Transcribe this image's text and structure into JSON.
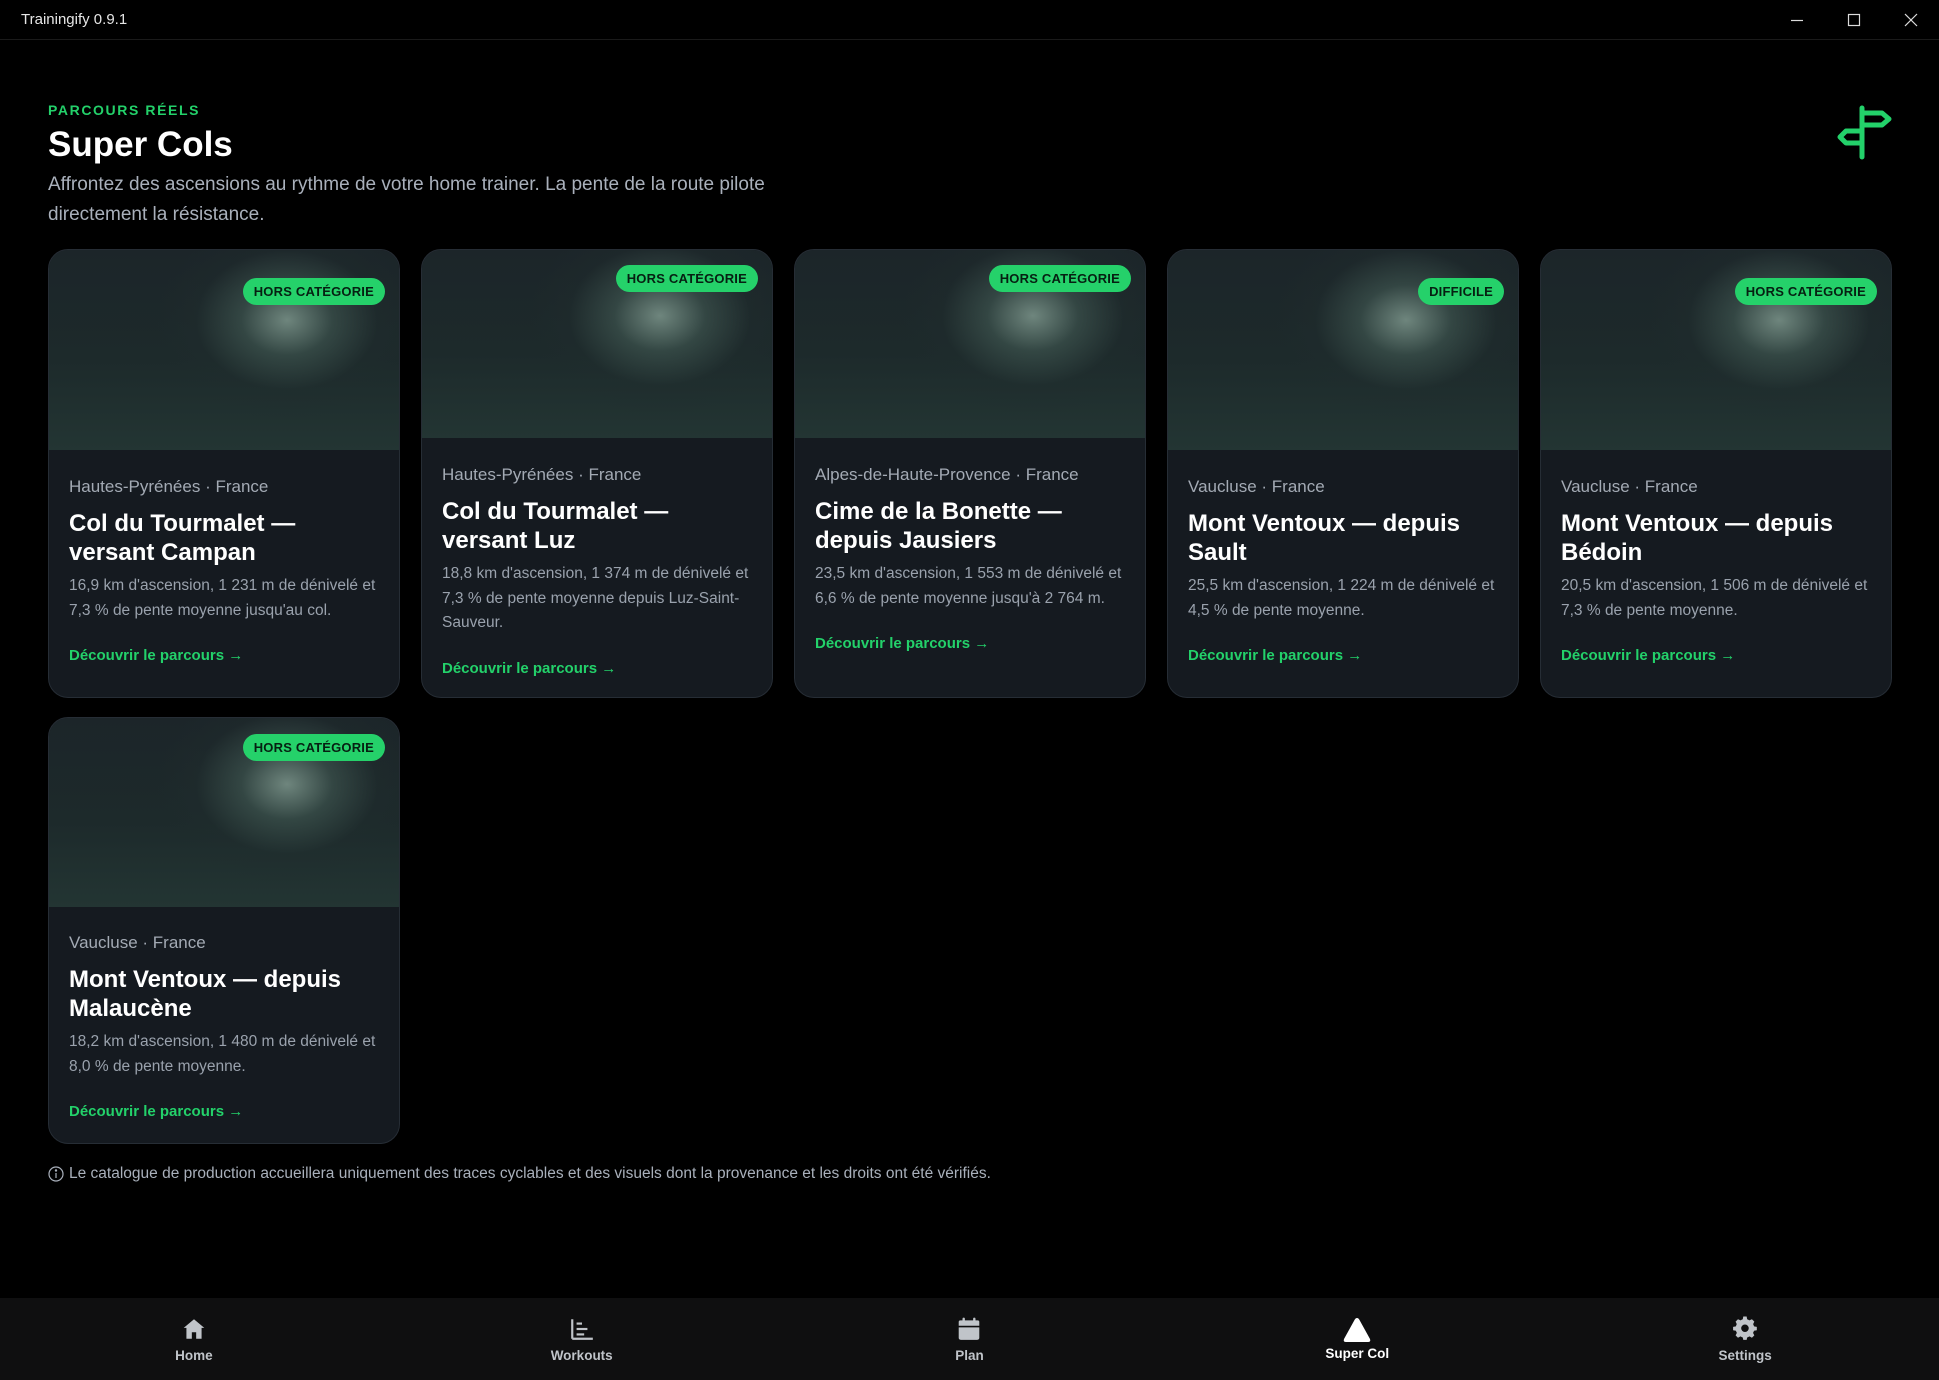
{
  "window": {
    "title": "Trainingify 0.9.1"
  },
  "header": {
    "eyebrow": "PARCOURS RÉELS",
    "title": "Super Cols",
    "subtitle": "Affrontez des ascensions au rythme de votre home trainer. La pente de la route pilote directement la résistance.",
    "icon": "signpost-icon"
  },
  "cards": [
    {
      "badge": "HORS CATÉGORIE",
      "region": "Hautes-Pyrénées · France",
      "title": "Col du Tourmalet — versant Campan",
      "description": "16,9 km d'ascension, 1 231 m de dénivelé et 7,3 % de pente moyenne jusqu'au col.",
      "link": "Découvrir le parcours →"
    },
    {
      "badge": "HORS CATÉGORIE",
      "region": "Hautes-Pyrénées · France",
      "title": "Col du Tourmalet — versant Luz",
      "description": "18,8 km d'ascension, 1 374 m de dénivelé et 7,3 % de pente moyenne depuis Luz-Saint-Sauveur.",
      "link": "Découvrir le parcours →"
    },
    {
      "badge": "HORS CATÉGORIE",
      "region": "Alpes-de-Haute-Provence · France",
      "title": "Cime de la Bonette — depuis Jausiers",
      "description": "23,5 km d'ascension, 1 553 m de dénivelé et 6,6 % de pente moyenne jusqu'à 2 764 m.",
      "link": "Découvrir le parcours →"
    },
    {
      "badge": "DIFFICILE",
      "region": "Vaucluse · France",
      "title": "Mont Ventoux — depuis Sault",
      "description": "25,5 km d'ascension, 1 224 m de dénivelé et 4,5 % de pente moyenne.",
      "link": "Découvrir le parcours →"
    },
    {
      "badge": "HORS CATÉGORIE",
      "region": "Vaucluse · France",
      "title": "Mont Ventoux — depuis Bédoin",
      "description": "20,5 km d'ascension, 1 506 m de dénivelé et 7,3 % de pente moyenne.",
      "link": "Découvrir le parcours →"
    },
    {
      "badge": "HORS CATÉGORIE",
      "region": "Vaucluse · France",
      "title": "Mont Ventoux — depuis Malaucène",
      "description": "18,2 km d'ascension, 1 480 m de dénivelé et 8,0 % de pente moyenne.",
      "link": "Découvrir le parcours →"
    }
  ],
  "footnote": "Le catalogue de production accueillera uniquement des traces cyclables et des visuels dont la provenance et les droits ont été vérifiés.",
  "nav": {
    "items": [
      {
        "label": "Home",
        "icon": "home-icon"
      },
      {
        "label": "Workouts",
        "icon": "workouts-icon"
      },
      {
        "label": "Plan",
        "icon": "calendar-icon"
      },
      {
        "label": "Super Col",
        "icon": "mountain-icon",
        "active": true
      },
      {
        "label": "Settings",
        "icon": "gear-icon"
      }
    ]
  },
  "colors": {
    "accent": "#23d16a",
    "background": "#000000",
    "card": "#151a20"
  }
}
